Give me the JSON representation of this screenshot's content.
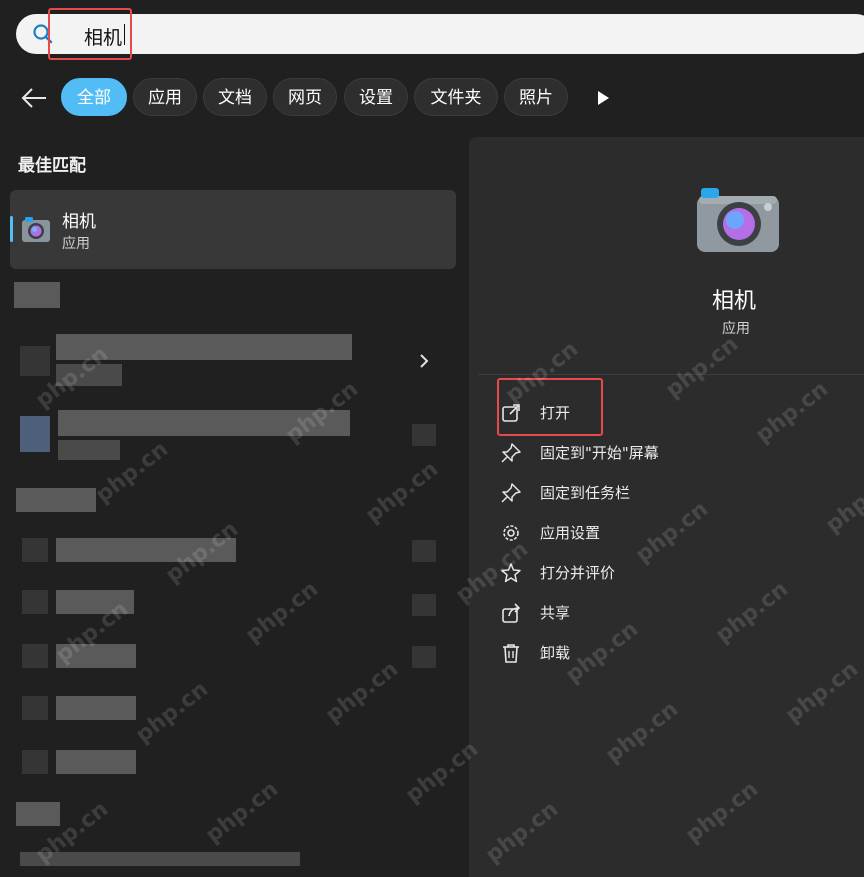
{
  "search": {
    "query": "相机"
  },
  "filters": {
    "tabs": [
      "全部",
      "应用",
      "文档",
      "网页",
      "设置",
      "文件夹",
      "照片"
    ],
    "active_index": 0
  },
  "left": {
    "section_title": "最佳匹配",
    "best_match": {
      "name": "相机",
      "type": "应用"
    }
  },
  "detail": {
    "app_name": "相机",
    "app_type": "应用",
    "actions": [
      {
        "label": "打开",
        "icon": "open-external-icon"
      },
      {
        "label": "固定到\"开始\"屏幕",
        "icon": "pin-icon"
      },
      {
        "label": "固定到任务栏",
        "icon": "pin-icon"
      },
      {
        "label": "应用设置",
        "icon": "gear-icon"
      },
      {
        "label": "打分并评价",
        "icon": "star-rate-icon"
      },
      {
        "label": "共享",
        "icon": "share-icon"
      },
      {
        "label": "卸载",
        "icon": "trash-icon"
      }
    ]
  },
  "watermark": "php.cn",
  "colors": {
    "accent": "#52bdf4",
    "highlight_box": "#e84a4a",
    "background": "#202020",
    "panel": "#2c2c2c"
  }
}
